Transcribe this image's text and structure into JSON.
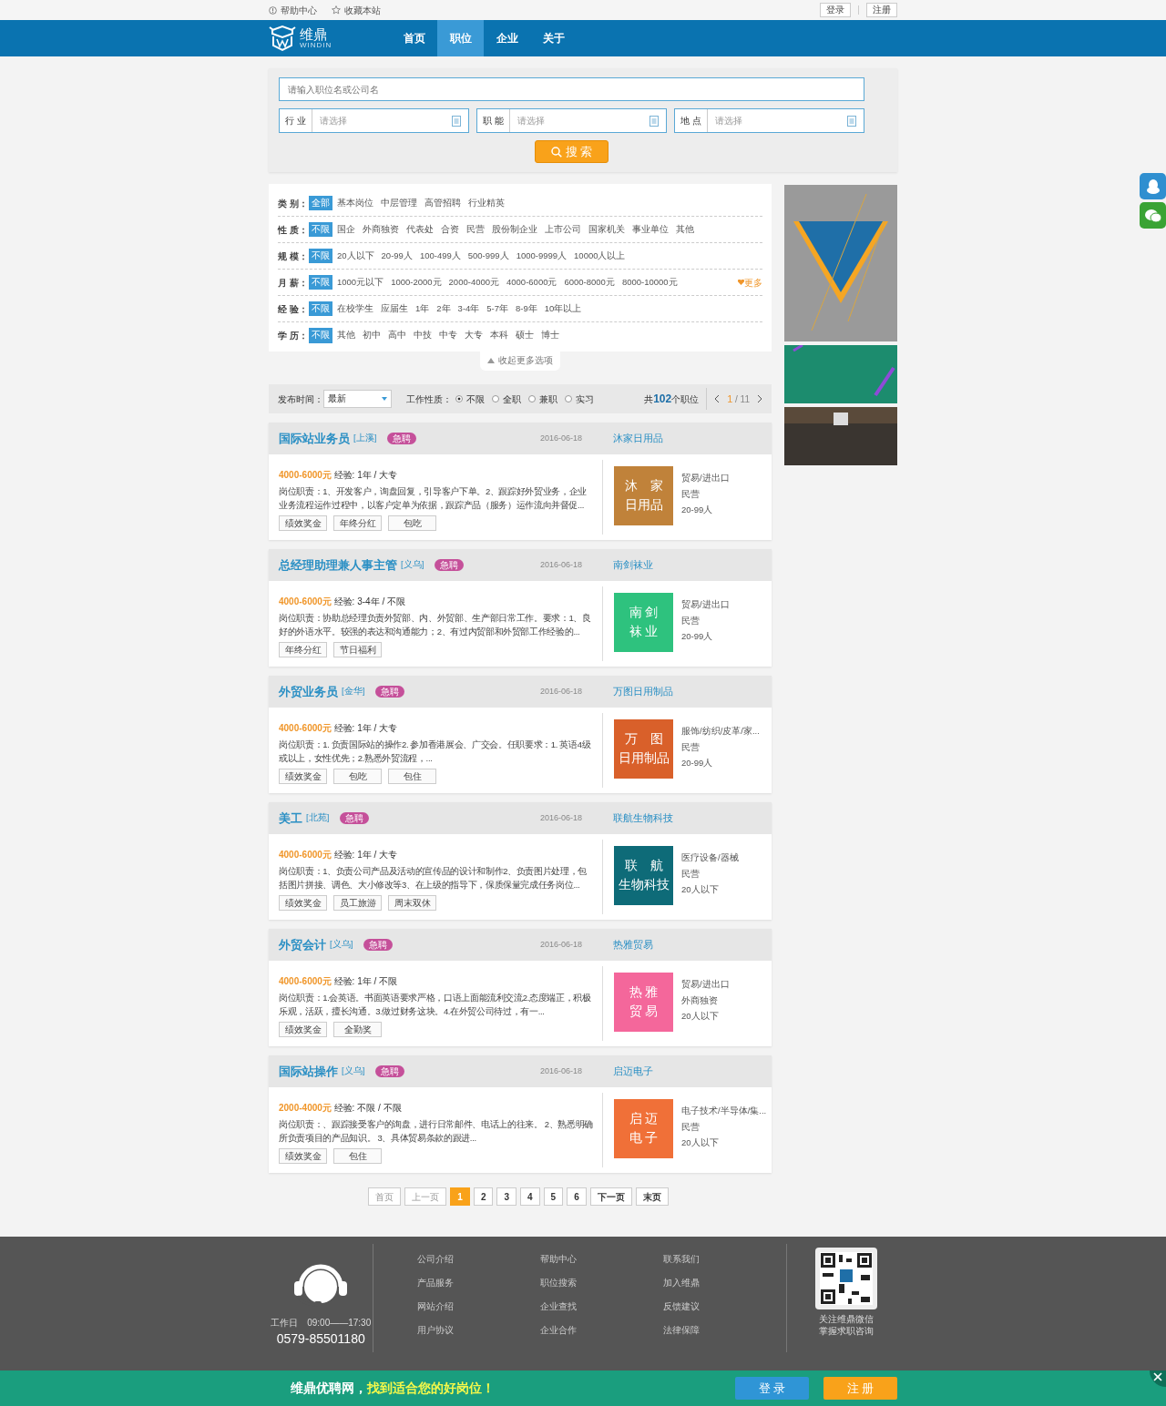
{
  "top_bar": {
    "links": [
      {
        "label": "帮助中心",
        "kind": "help"
      },
      {
        "label": "收藏本站",
        "kind": "star"
      }
    ],
    "auth_buttons": [
      "登录",
      "注册"
    ]
  },
  "nav": {
    "logo": {
      "name": "维鼎",
      "sub": "WINDIN"
    },
    "items": [
      {
        "label": "首页",
        "selected": false
      },
      {
        "label": "职位",
        "selected": true
      },
      {
        "label": "企业",
        "selected": false
      },
      {
        "label": "关于",
        "selected": false
      }
    ]
  },
  "search": {
    "placeholder": "请输入职位名或公司名",
    "selects": [
      {
        "label": "行 业",
        "placeholder": "请选择"
      },
      {
        "label": "职 能",
        "placeholder": "请选择"
      },
      {
        "label": "地 点",
        "placeholder": "请选择"
      }
    ],
    "button": "搜 索"
  },
  "filters": [
    {
      "label": "类 别：",
      "options": [
        {
          "label": "全部",
          "selected": true
        },
        {
          "label": "基本岗位",
          "selected": false
        },
        {
          "label": "中层管理",
          "selected": false
        },
        {
          "label": "高管招聘",
          "selected": false
        },
        {
          "label": "行业精英",
          "selected": false
        }
      ]
    },
    {
      "label": "性 质：",
      "options": [
        {
          "label": "不限",
          "selected": true
        },
        {
          "label": "国企",
          "selected": false
        },
        {
          "label": "外商独资",
          "selected": false
        },
        {
          "label": "代表处",
          "selected": false
        },
        {
          "label": "合资",
          "selected": false
        },
        {
          "label": "民营",
          "selected": false
        },
        {
          "label": "股份制企业",
          "selected": false
        },
        {
          "label": "上市公司",
          "selected": false
        },
        {
          "label": "国家机关",
          "selected": false
        },
        {
          "label": "事业单位",
          "selected": false
        },
        {
          "label": "其他",
          "selected": false
        }
      ]
    },
    {
      "label": "规 模：",
      "options": [
        {
          "label": "不限",
          "selected": true
        },
        {
          "label": "20人以下",
          "selected": false
        },
        {
          "label": "20-99人",
          "selected": false
        },
        {
          "label": "100-499人",
          "selected": false
        },
        {
          "label": "500-999人",
          "selected": false
        },
        {
          "label": "1000-9999人",
          "selected": false
        },
        {
          "label": "10000人以上",
          "selected": false
        }
      ]
    },
    {
      "label": "月 薪：",
      "more": "更多",
      "options": [
        {
          "label": "不限",
          "selected": true
        },
        {
          "label": "1000元以下",
          "selected": false
        },
        {
          "label": "1000-2000元",
          "selected": false
        },
        {
          "label": "2000-4000元",
          "selected": false
        },
        {
          "label": "4000-6000元",
          "selected": false
        },
        {
          "label": "6000-8000元",
          "selected": false
        },
        {
          "label": "8000-10000元",
          "selected": false
        }
      ]
    },
    {
      "label": "经 验：",
      "options": [
        {
          "label": "不限",
          "selected": true
        },
        {
          "label": "在校学生",
          "selected": false
        },
        {
          "label": "应届生",
          "selected": false
        },
        {
          "label": "1年",
          "selected": false
        },
        {
          "label": "2年",
          "selected": false
        },
        {
          "label": "3-4年",
          "selected": false
        },
        {
          "label": "5-7年",
          "selected": false
        },
        {
          "label": "8-9年",
          "selected": false
        },
        {
          "label": "10年以上",
          "selected": false
        }
      ]
    },
    {
      "label": "学 历：",
      "options": [
        {
          "label": "不限",
          "selected": true
        },
        {
          "label": "其他",
          "selected": false
        },
        {
          "label": "初中",
          "selected": false
        },
        {
          "label": "高中",
          "selected": false
        },
        {
          "label": "中技",
          "selected": false
        },
        {
          "label": "中专",
          "selected": false
        },
        {
          "label": "大专",
          "selected": false
        },
        {
          "label": "本科",
          "selected": false
        },
        {
          "label": "硕士",
          "selected": false
        },
        {
          "label": "博士",
          "selected": false
        }
      ]
    }
  ],
  "collapse_link": "收起更多选项",
  "toolbar": {
    "publish_label": "发布时间：",
    "publish_value": "最新",
    "type_label": "工作性质：",
    "type_options": [
      {
        "label": "不限",
        "selected": true
      },
      {
        "label": "全职",
        "selected": false
      },
      {
        "label": "兼职",
        "selected": false
      },
      {
        "label": "实习",
        "selected": false
      }
    ],
    "total_prefix": "共",
    "total_count": "102",
    "total_suffix": "个职位",
    "page_current": "1",
    "page_total": "/ 11"
  },
  "jobs": [
    {
      "title": "国际站业务员",
      "location": "[上溪]",
      "badge": "急聘",
      "date": "2016-06-18",
      "company": "沐家日用品",
      "salary": "4000-6000元",
      "requirements": "经验: 1年 / 大专",
      "description": "岗位职责：1、开发客户，询盘回复，引导客户下单。2、跟踪好外贸业务，企业业务流程运作过程中，以客户定单为依据，跟踪产品（服务）运作流向并督促...",
      "tags": [
        "绩效奖金",
        "年终分红",
        "包吃"
      ],
      "logo_lines": [
        "沐　家",
        "日用品"
      ],
      "color": "#c0823a",
      "industry": "贸易/进出口",
      "ownership": "民营",
      "size": "20-99人"
    },
    {
      "title": "总经理助理兼人事主管",
      "location": "[义乌]",
      "badge": "急聘",
      "date": "2016-06-18",
      "company": "南剑袜业",
      "salary": "4000-6000元",
      "requirements": "经验: 3-4年 / 不限",
      "description": "岗位职责：协助总经理负责外贸部、内、外贸部、生产部日常工作。要求：1、良好的外语水平。较强的表达和沟通能力；2、有过内贸部和外贸部工作经验的...",
      "tags": [
        "年终分红",
        "节日福利"
      ],
      "logo_lines": [
        "南 剑",
        "袜 业"
      ],
      "color": "#2ec27e",
      "industry": "贸易/进出口",
      "ownership": "民营",
      "size": "20-99人"
    },
    {
      "title": "外贸业务员",
      "location": "[金华]",
      "badge": "急聘",
      "date": "2016-06-18",
      "company": "万图日用制品",
      "salary": "4000-6000元",
      "requirements": "经验: 1年 / 大专",
      "description": "岗位职责：1. 负责国际站的操作2. 参加香港展会、广交会。任职要求：1. 英语4级或以上，女性优先；2.熟悉外贸流程，...",
      "tags": [
        "绩效奖金",
        "包吃",
        "包住"
      ],
      "logo_lines": [
        "万　图",
        "日用制品"
      ],
      "color": "#d9602a",
      "industry": "服饰/纺织/皮革/家...",
      "ownership": "民营",
      "size": "20-99人"
    },
    {
      "title": "美工",
      "location": "[北苑]",
      "badge": "急聘",
      "date": "2016-06-18",
      "company": "联航生物科技",
      "salary": "4000-6000元",
      "requirements": "经验: 1年 / 大专",
      "description": "岗位职责：1、负责公司产品及活动的宣传品的设计和制作2、负责图片处理，包括图片拼接、调色、大小修改等3、在上级的指导下，保质保量完成任务岗位...",
      "tags": [
        "绩效奖金",
        "员工旅游",
        "周末双休"
      ],
      "logo_lines": [
        "联　航",
        "生物科技"
      ],
      "color": "#0e6b78",
      "industry": "医疗设备/器械",
      "ownership": "民营",
      "size": "20人以下"
    },
    {
      "title": "外贸会计",
      "location": "[义乌]",
      "badge": "急聘",
      "date": "2016-06-18",
      "company": "热雅贸易",
      "salary": "4000-6000元",
      "requirements": "经验: 1年 / 不限",
      "description": "岗位职责：1.会英语。书面英语要求严格，口语上面能流利交流2.态度端正，积极乐观，活跃，擅长沟通。3.做过财务这块。4.在外贸公司待过，有一...",
      "tags": [
        "绩效奖金",
        "全勤奖"
      ],
      "logo_lines": [
        "热 雅",
        "贸 易"
      ],
      "color": "#f4679b",
      "industry": "贸易/进出口",
      "ownership": "外商独资",
      "size": "20人以下"
    },
    {
      "title": "国际站操作",
      "location": "[义乌]",
      "badge": "急聘",
      "date": "2016-06-18",
      "company": "启迈电子",
      "salary": "2000-4000元",
      "requirements": "经验: 不限 / 不限",
      "description": "岗位职责：、跟踪接受客户的询盘，进行日常邮件、电话上的往来。 2、熟悉明确所负责项目的产品知识。 3、具体贸易条款的跟进...",
      "tags": [
        "绩效奖金",
        "包住"
      ],
      "logo_lines": [
        "启 迈",
        "电 子"
      ],
      "color": "#f07038",
      "industry": "电子技术/半导体/集...",
      "ownership": "民营",
      "size": "20人以下"
    }
  ],
  "pagination": [
    {
      "label": "首页",
      "selected": false,
      "disabled": true
    },
    {
      "label": "上一页",
      "selected": false,
      "disabled": true
    },
    {
      "label": "1",
      "selected": true,
      "disabled": false
    },
    {
      "label": "2",
      "selected": false,
      "disabled": false
    },
    {
      "label": "3",
      "selected": false,
      "disabled": false
    },
    {
      "label": "4",
      "selected": false,
      "disabled": false
    },
    {
      "label": "5",
      "selected": false,
      "disabled": false
    },
    {
      "label": "6",
      "selected": false,
      "disabled": false
    },
    {
      "label": "下一页",
      "selected": false,
      "disabled": false
    },
    {
      "label": "末页",
      "selected": false,
      "disabled": false
    }
  ],
  "footer": {
    "hours": "工作日　09:00——17:30",
    "phone": "0579-85501180",
    "link_columns": [
      [
        "公司介绍",
        "产品服务",
        "网站介绍",
        "用户协议"
      ],
      [
        "帮助中心",
        "职位搜索",
        "企业查找",
        "企业合作"
      ],
      [
        "联系我们",
        "加入维鼎",
        "反馈建议",
        "法律保障"
      ]
    ],
    "qr_caption": [
      "关注维鼎微信",
      "掌握求职咨询"
    ]
  },
  "promo_bar": {
    "brand": "维鼎优聘网，",
    "slogan": "找到适合您的好岗位！",
    "buttons": [
      "登 录",
      "注 册"
    ]
  }
}
